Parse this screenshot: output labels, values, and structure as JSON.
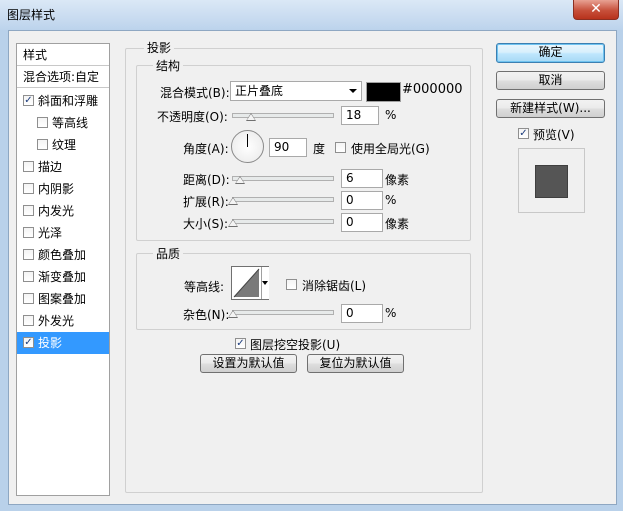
{
  "window": {
    "title": "图层样式",
    "close_glyph": "✕"
  },
  "style_list": {
    "header": "样式",
    "blend_options": "混合选项:自定",
    "items": [
      {
        "label": "斜面和浮雕",
        "checked": true
      },
      {
        "label": "等高线",
        "checked": false
      },
      {
        "label": "纹理",
        "checked": false
      },
      {
        "label": "描边",
        "checked": false
      },
      {
        "label": "内阴影",
        "checked": false
      },
      {
        "label": "内发光",
        "checked": false
      },
      {
        "label": "光泽",
        "checked": false
      },
      {
        "label": "颜色叠加",
        "checked": false
      },
      {
        "label": "渐变叠加",
        "checked": false
      },
      {
        "label": "图案叠加",
        "checked": false
      },
      {
        "label": "外发光",
        "checked": false
      },
      {
        "label": "投影",
        "checked": true,
        "selected": true
      }
    ]
  },
  "drop_shadow": {
    "title": "投影",
    "structure": {
      "title": "结构",
      "blend_mode_label": "混合模式(B):",
      "blend_mode_value": "正片叠底",
      "color_hex": "#000000",
      "opacity_label": "不透明度(O):",
      "opacity_value": "18",
      "opacity_unit": "%",
      "angle_label": "角度(A):",
      "angle_value": "90",
      "angle_unit": "度",
      "global_light_label": "使用全局光(G)",
      "global_light_checked": false,
      "distance_label": "距离(D):",
      "distance_value": "6",
      "distance_unit": "像素",
      "spread_label": "扩展(R):",
      "spread_value": "0",
      "spread_unit": "%",
      "size_label": "大小(S):",
      "size_value": "0",
      "size_unit": "像素"
    },
    "quality": {
      "title": "品质",
      "contour_label": "等高线:",
      "antialias_label": "消除锯齿(L)",
      "antialias_checked": false,
      "noise_label": "杂色(N):",
      "noise_value": "0",
      "noise_unit": "%"
    },
    "knockout_label": "图层挖空投影(U)",
    "knockout_checked": true,
    "set_default_label": "设置为默认值",
    "reset_default_label": "复位为默认值"
  },
  "buttons": {
    "ok": "确定",
    "cancel": "取消",
    "new_style": "新建样式(W)...",
    "preview_label": "预览(V)",
    "preview_checked": true
  },
  "check_glyph": "✓"
}
